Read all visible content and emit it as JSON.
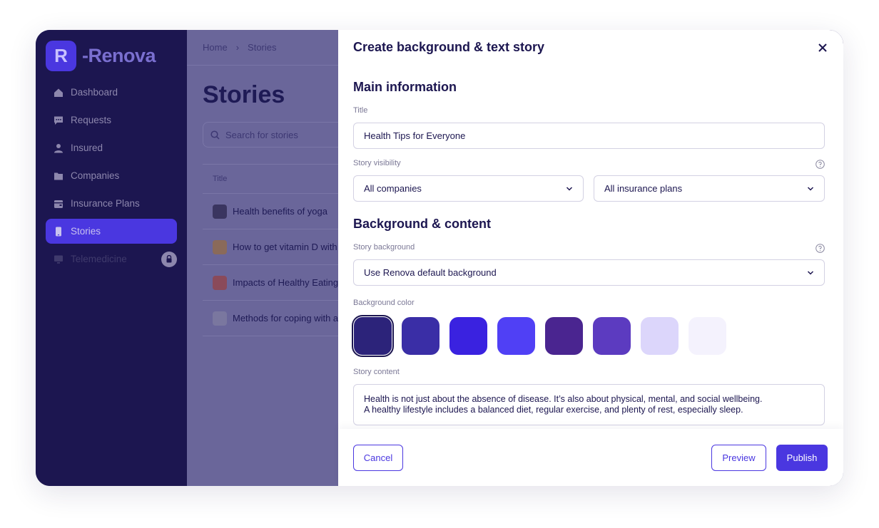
{
  "brand": {
    "logo_mark": "R",
    "name": "-Renova"
  },
  "sidebar": {
    "items": [
      {
        "label": "Dashboard",
        "icon": "home-icon"
      },
      {
        "label": "Requests",
        "icon": "chat-icon"
      },
      {
        "label": "Insured",
        "icon": "user-icon"
      },
      {
        "label": "Companies",
        "icon": "folder-icon"
      },
      {
        "label": "Insurance Plans",
        "icon": "wallet-icon"
      },
      {
        "label": "Stories",
        "icon": "phone-icon",
        "active": true
      },
      {
        "label": "Telemedicine",
        "icon": "monitor-icon",
        "locked": true
      }
    ]
  },
  "main": {
    "breadcrumb": {
      "home": "Home",
      "current": "Stories"
    },
    "title": "Stories",
    "search_placeholder": "Search for stories",
    "table": {
      "header": "Title",
      "rows": [
        {
          "title": "Health benefits of yoga",
          "thumb_color": "#3a3560"
        },
        {
          "title": "How to get vitamin D with",
          "thumb_color": "#8a6a5a"
        },
        {
          "title": "Impacts of Healthy Eating",
          "thumb_color": "#8a4a5a"
        },
        {
          "title": "Methods for coping with a",
          "thumb_color": "#7a779f"
        }
      ]
    }
  },
  "modal": {
    "title": "Create background & text story",
    "main_info_title": "Main information",
    "title_label": "Title",
    "title_value": "Health Tips for Everyone",
    "visibility_label": "Story visibility",
    "companies_value": "All companies",
    "plans_value": "All insurance plans",
    "bg_content_title": "Background & content",
    "bg_label": "Story background",
    "bg_value": "Use Renova default background",
    "color_label": "Background color",
    "swatches": [
      "#2c237a",
      "#3a2ea6",
      "#3a22e0",
      "#5040f5",
      "#4a2590",
      "#5c3bc0",
      "#dcd6fb",
      "#f4f2fd"
    ],
    "content_label": "Story content",
    "content_line1": "Health is not just about the absence of disease. It’s also about physical, mental, and social wellbeing.",
    "content_line2": "A healthy lifestyle includes a balanced diet, regular exercise, and plenty of rest, especially sleep.",
    "cancel_label": "Cancel",
    "preview_label": "Preview",
    "publish_label": "Publish"
  },
  "colors": {
    "accent": "#4a37e0",
    "sidebar_bg": "#1c1650",
    "overlay": "#6a669a"
  }
}
